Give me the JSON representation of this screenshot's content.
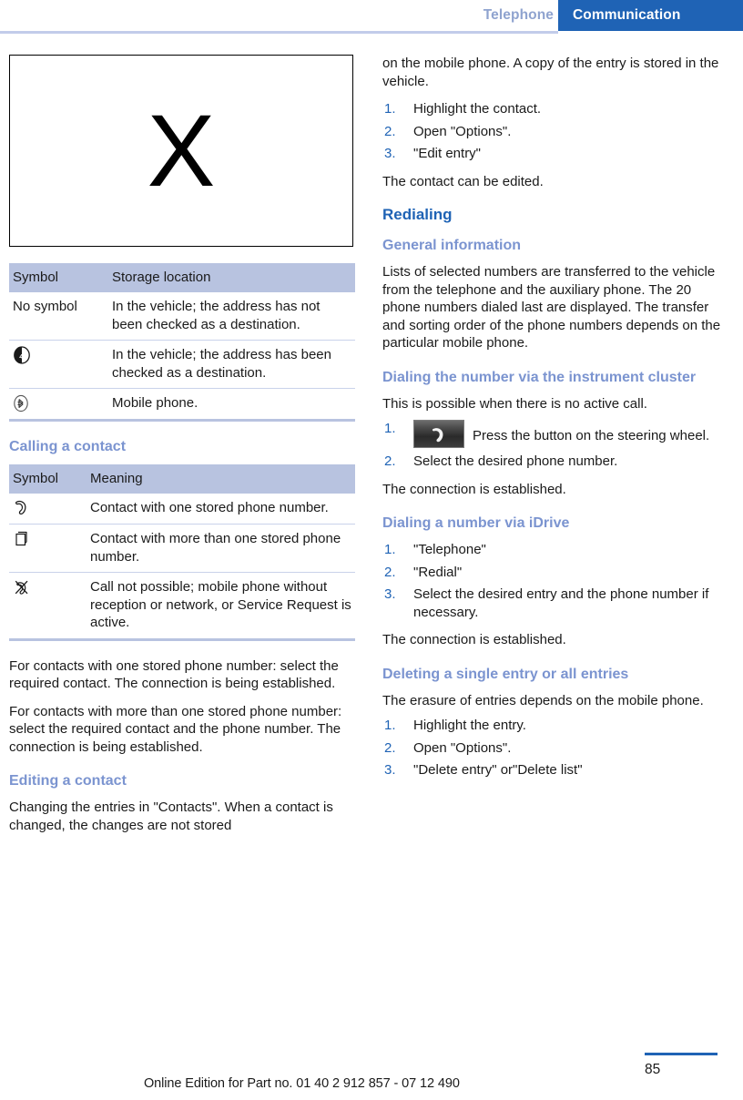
{
  "header": {
    "chapter_label": "Telephone",
    "section_label": "Communication"
  },
  "left_column": {
    "figure": {
      "placeholder_glyph": "X",
      "alt": "missing-image-placeholder"
    },
    "storage_table": {
      "columns": [
        "Symbol",
        "Storage location"
      ],
      "rows": [
        {
          "symbol_text": "No symbol",
          "symbol_icon": "",
          "meaning": "In the vehicle; the address has not been checked as a destination."
        },
        {
          "symbol_text": "",
          "symbol_icon": "filled-circle-arrow-icon",
          "meaning": "In the vehicle; the address has been checked as a destination."
        },
        {
          "symbol_text": "",
          "symbol_icon": "bluetooth-circle-icon",
          "meaning": "Mobile phone."
        }
      ]
    },
    "calling_heading": "Calling a contact",
    "meaning_table": {
      "columns": [
        "Symbol",
        "Meaning"
      ],
      "rows": [
        {
          "symbol_icon": "phone-handset-icon",
          "meaning": "Contact with one stored phone number."
        },
        {
          "symbol_icon": "stacked-pages-icon",
          "meaning": "Contact with more than one stored phone number."
        },
        {
          "symbol_icon": "handset-crossed-out-icon",
          "meaning": "Call not possible; mobile phone without reception or network, or Service Request is active."
        }
      ]
    },
    "paragraph_one_number": "For contacts with one stored phone number: select the required contact. The connection is being established.",
    "paragraph_more_numbers": "For contacts with more than one stored phone number: select the required contact and the phone number. The connection is being established.",
    "editing_heading": "Editing a contact",
    "editing_text": "Changing the entries in \"Contacts\". When a contact is changed, the changes are not stored"
  },
  "right_column": {
    "continued_text": "on the mobile phone. A copy of the entry is stored in the vehicle.",
    "edit_steps": [
      "Highlight the contact.",
      "Open \"Options\".",
      "\"Edit entry\""
    ],
    "edit_result": "The contact can be edited.",
    "redialing_heading": "Redialing",
    "general_information_heading": "General information",
    "general_information_text": "Lists of selected numbers are transferred to the vehicle from the telephone and the auxiliary phone. The 20 phone numbers dialed last are displayed. The transfer and sorting order of the phone numbers depends on the particular mobile phone.",
    "instrument_cluster_heading": "Dialing the number via the instrument cluster",
    "instrument_cluster_intro": "This is possible when there is no active call.",
    "instrument_cluster_steps": [
      "Press the button on the steering wheel.",
      "Select the desired phone number."
    ],
    "instrument_cluster_result": "The connection is established.",
    "idrive_heading": "Dialing a number via iDrive",
    "idrive_steps": [
      "\"Telephone\"",
      "\"Redial\"",
      "Select the desired entry and the phone number if necessary."
    ],
    "idrive_result": "The connection is established.",
    "deleting_heading": "Deleting a single entry or all entries",
    "deleting_intro": "The erasure of entries depends on the mobile phone.",
    "deleting_steps": [
      "Highlight the entry.",
      "Open \"Options\".",
      "\"Delete entry\" or\"Delete list\""
    ]
  },
  "footer": {
    "note": "Online Edition for Part no. 01 40 2 912 857 - 07 12 490",
    "page_number": "85"
  },
  "colors": {
    "accent_blue": "#1f63b5",
    "light_blue": "#7b94d0",
    "header_chapter_blue": "#8fa3cf",
    "table_header_bg": "#b8c3e0",
    "rule_blue": "#c2ccea"
  }
}
